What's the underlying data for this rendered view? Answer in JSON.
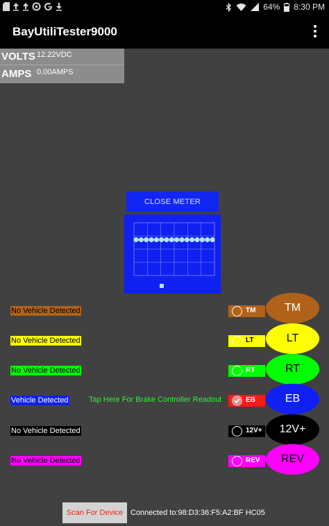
{
  "status_bar": {
    "battery": "64%",
    "time": "8:30 PM",
    "left_icons": [
      "sd-card-icon",
      "upload-icon",
      "upload-icon",
      "settings-icon",
      "google-icon",
      "download-icon"
    ],
    "right_icons": [
      "bluetooth-icon",
      "wifi-icon",
      "cell-signal-icon",
      "battery-icon"
    ]
  },
  "app_bar": {
    "title": "BayUtiliTester9000",
    "overflow_icon": "more-vert-icon"
  },
  "meter": {
    "volts_label": "VOLTS",
    "volts_value": "12.22VDC",
    "amps_label": "AMPS",
    "amps_value": "0.00AMPS"
  },
  "close_meter_label": "CLOSE METER",
  "chart_data": {
    "type": "line",
    "series": [
      {
        "values": [
          12.2,
          12.2,
          12.2,
          12.2,
          12.2,
          12.2,
          12.2,
          12.2,
          12.2,
          12.2,
          12.2,
          12.2,
          12.2,
          12.2,
          12.2,
          12.2
        ]
      }
    ],
    "grid": true,
    "legend": "bottom",
    "colors": {
      "background": "#1020f0",
      "line": "#b7e3f2",
      "grid": "#8aa0ff"
    }
  },
  "circuits": [
    {
      "status": "No Vehicle Detected",
      "toggle_label": "TM",
      "oval_label": "TM",
      "color": "#b0621a",
      "text_color": "#ffffff",
      "status_text_color": "#000000",
      "toggle_text_color": "#ffffff",
      "checked": false
    },
    {
      "status": "No Vehicle Detected",
      "toggle_label": "LT",
      "oval_label": "LT",
      "color": "#ffff00",
      "text_color": "#000000",
      "status_text_color": "#000000",
      "toggle_text_color": "#000000",
      "checked": false
    },
    {
      "status": "No Vehicle Detected",
      "toggle_label": "RT",
      "oval_label": "RT",
      "color": "#00ff00",
      "text_color": "#000000",
      "status_text_color": "#000000",
      "toggle_text_color": "#ffffff",
      "checked": false
    },
    {
      "status": "Vehicle Detected",
      "toggle_label": "EB",
      "oval_label": "EB",
      "color": "#1020f5",
      "text_color": "#ffffff",
      "status_text_color": "#ffffff",
      "toggle_text_color": "#ffffff",
      "toggle_bg": "#ff1a1a",
      "checked": true
    },
    {
      "status": "No Vehicle Detected",
      "toggle_label": "12V+",
      "oval_label": "12V+",
      "color": "#000000",
      "text_color": "#ffffff",
      "status_text_color": "#ffffff",
      "toggle_text_color": "#ffffff",
      "checked": false
    },
    {
      "status": "No Vehicle Detected",
      "toggle_label": "REV",
      "oval_label": "REV",
      "color": "#ff00ff",
      "text_color": "#000000",
      "status_text_color": "#000000",
      "toggle_text_color": "#ffffff",
      "checked": false
    }
  ],
  "brake_readout_text": "Tap Here For Brake Controller Readout",
  "scan_button_label": "Scan For Device",
  "connection_text": "Connected to:98:D3:36:F5:A2:BF HC05"
}
